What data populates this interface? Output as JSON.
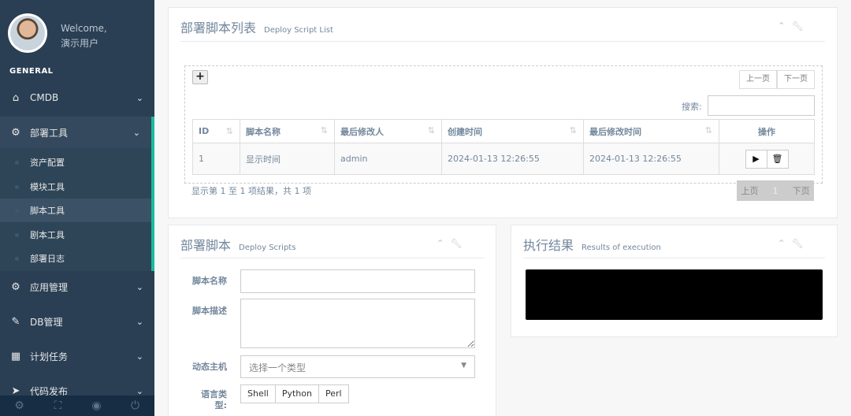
{
  "sidebar": {
    "welcome": "Welcome,",
    "username": "演示用户",
    "section": "GENERAL",
    "items": [
      {
        "label": "CMDB",
        "icon": "home-icon"
      },
      {
        "label": "部署工具",
        "icon": "cogs-icon"
      },
      {
        "label": "应用管理",
        "icon": "gear-icon"
      },
      {
        "label": "DB管理",
        "icon": "edit-icon"
      },
      {
        "label": "计划任务",
        "icon": "calendar-icon"
      },
      {
        "label": "代码发布",
        "icon": "send-icon"
      }
    ],
    "submenu": [
      "资产配置",
      "模块工具",
      "脚本工具",
      "剧本工具",
      "部署日志"
    ],
    "footer_icons": [
      "settings-icon",
      "fullscreen-icon",
      "lock-icon",
      "logout-icon"
    ]
  },
  "list_panel": {
    "title": "部署脚本列表",
    "subtitle": "Deploy Script List",
    "add_label": "+",
    "prev": "上一页",
    "next": "下一页",
    "search_label": "搜索:",
    "search_value": "",
    "columns": [
      "ID",
      "脚本名称",
      "最后修改人",
      "创建时间",
      "最后修改时间",
      "操作"
    ],
    "rows": [
      {
        "id": "1",
        "name": "显示时间",
        "modifier": "admin",
        "created": "2024-01-13 12:26:55",
        "modified": "2024-01-13 12:26:55"
      }
    ],
    "info": "显示第 1 至 1 项结果，共 1 项",
    "pager_prev": "上页",
    "pager_current": "1",
    "pager_next": "下页"
  },
  "form_panel": {
    "title": "部署脚本",
    "subtitle": "Deploy Scripts",
    "name_label": "脚本名称",
    "desc_label": "脚本描述",
    "host_label": "动态主机",
    "host_placeholder": "选择一个类型",
    "lang_label": "语言类型:",
    "langs": [
      "Shell",
      "Python",
      "Perl"
    ]
  },
  "result_panel": {
    "title": "执行结果",
    "subtitle": "Results of execution"
  },
  "colors": {
    "sidebar_bg": "#2a3f54",
    "accent": "#1abb9c",
    "footer_bg": "#172d44"
  }
}
